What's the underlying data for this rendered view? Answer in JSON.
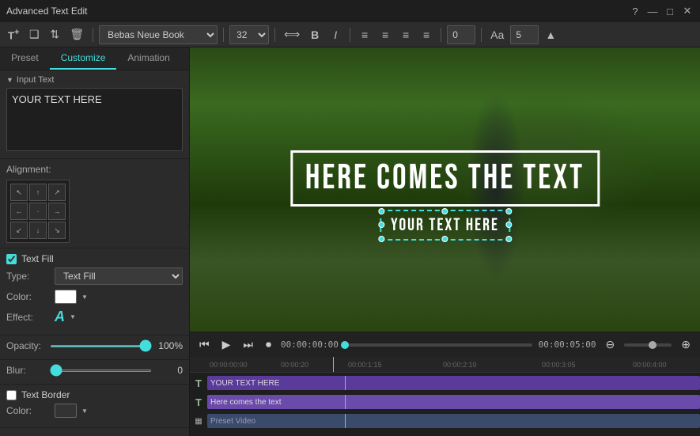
{
  "window": {
    "title": "Advanced Text Edit"
  },
  "tabs": {
    "preset": "Preset",
    "customize": "Customize",
    "animation": "Animation",
    "active": "Customize"
  },
  "toolbar": {
    "font": "Bebas Neue Book",
    "font_size": "32",
    "bold_label": "B",
    "italic_label": "I",
    "spacing_value": "0",
    "extra_value": "5",
    "add_icon": "T+",
    "copy_icon": "❑",
    "arrange_icon": "⟳",
    "delete_icon": "🗑",
    "align_left": "≡",
    "align_center": "≡",
    "align_right": "≡",
    "align_justify": "≡"
  },
  "left_panel": {
    "input_text_label": "Input Text",
    "input_text_value": "YOUR TEXT HERE",
    "alignment_label": "Alignment:",
    "text_fill_label": "Text Fill",
    "text_fill_checked": true,
    "type_label": "Type:",
    "type_value": "Text Fill",
    "color_label": "Color:",
    "effect_label": "Effect:",
    "opacity_label": "Opacity:",
    "opacity_value": "100%",
    "blur_label": "Blur:",
    "blur_value": "0",
    "text_border_label": "Text Border",
    "text_border_checked": false,
    "border_color_label": "Color:"
  },
  "video": {
    "main_text": "HERE COMES THE TEXT",
    "sub_text": "YOUR TEXT HERE"
  },
  "playback": {
    "current_time": "00:00:00:00",
    "end_time": "00:00:05:00",
    "time_markers": [
      "00:00:00:00",
      "00:00:20",
      "00:00:1:15",
      "00:00:2:10",
      "00:00:3:05",
      "00:00:4:00",
      "00:00:0"
    ]
  },
  "timeline": {
    "track1_clip": "YOUR TEXT HERE",
    "track2_clip": "Here comes the text",
    "track3_clip": "Preset Video",
    "cursor_left_pct": "28"
  },
  "title_bar": {
    "help": "?",
    "minimize": "—",
    "maximize": "□",
    "close": "✕"
  }
}
